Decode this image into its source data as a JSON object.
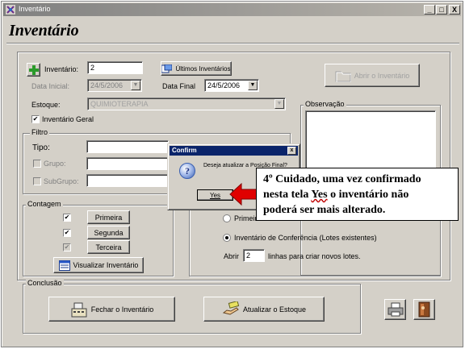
{
  "window": {
    "title": "Inventário",
    "buttons": {
      "minimize": "_",
      "maximize": "□",
      "close": "X"
    }
  },
  "page_title": "Inventário",
  "form": {
    "inventario_label": "Inventário:",
    "inventario_value": "2",
    "ultimos_button": "Últimos Inventários",
    "abrir_button": "Abrir o Inventário",
    "data_inicial_label": "Data Inicial:",
    "data_inicial_value": "24/5/2006",
    "data_final_label": "Data Final",
    "data_final_value": "24/5/2006",
    "estoque_label": "Estoque:",
    "estoque_value": "QUIMIOTERAPIA",
    "inventario_geral_label": "Inventário Geral",
    "observacao_label": "Observação"
  },
  "filtro": {
    "title": "Filtro",
    "tipo_label": "Tipo:",
    "grupo_label": "Grupo:",
    "subgrupo_label": "SubGrupo:"
  },
  "contagem": {
    "title": "Contagem",
    "primeira": "Primeira",
    "segunda": "Segunda",
    "terceira": "Terceira",
    "visualizar_button": "Visualizar Inventário"
  },
  "posicao": {
    "radio_primeira": "Primeir",
    "radio_conferencia": "Inventário de Conferência (Lotes existentes)",
    "abrir_label": "Abrir",
    "abrir_value": "2",
    "linhas_label": "linhas para criar novos lotes."
  },
  "conclusao": {
    "title": "Conclusão",
    "fechar_button": "Fechar o Inventário",
    "atualizar_button": "Atualizar o Estoque"
  },
  "dialog": {
    "title": "Confirm",
    "close": "x",
    "message": "Deseja atualizar a Posição Final?",
    "yes_button": "Yes"
  },
  "callout": {
    "line1": "4º Cuidado, uma vez confirmado",
    "line2_pre": "nesta tela ",
    "line2_yes": "Yes",
    "line2_post": " o inventário não",
    "line3": "poderá ser mais alterado."
  },
  "colors": {
    "title_bar": "#808080",
    "dialog_title": "#0a246a",
    "arrow": "#e00000",
    "face": "#d4d0c8"
  },
  "icons": [
    "app-icon",
    "plus-icon",
    "inventory-list-icon",
    "folder-icon",
    "view-icon",
    "cash-register-icon",
    "money-hand-icon",
    "printer-icon",
    "exit-door-icon",
    "question-icon",
    "red-arrow-icon"
  ]
}
